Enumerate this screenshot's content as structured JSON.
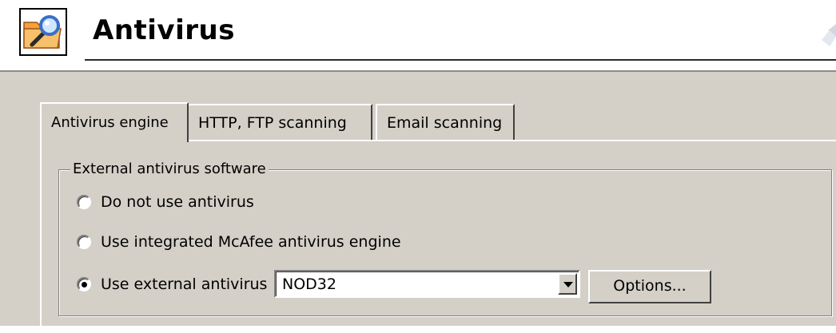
{
  "header": {
    "title": "Antivirus",
    "icon": "antivirus-folder-magnifier-icon"
  },
  "tabs": [
    {
      "label": "Antivirus engine",
      "active": true
    },
    {
      "label": "HTTP, FTP scanning",
      "active": false
    },
    {
      "label": "Email scanning",
      "active": false
    }
  ],
  "group": {
    "legend": "External antivirus software",
    "options": [
      {
        "label": "Do not use antivirus",
        "selected": false
      },
      {
        "label": "Use integrated McAfee antivirus engine",
        "selected": false
      },
      {
        "label": "Use external antivirus",
        "selected": true
      }
    ],
    "external_select_value": "NOD32",
    "options_button": "Options..."
  },
  "colors": {
    "panel": "#d4d0c8",
    "icon_orange": "#f3a33a",
    "icon_blue": "#3a6fc9"
  }
}
